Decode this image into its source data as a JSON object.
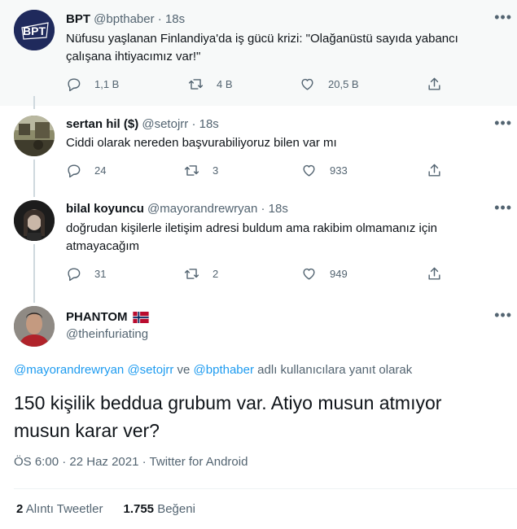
{
  "tweets": [
    {
      "name": "BPT",
      "handle": "@bpthaber",
      "time": "18s",
      "text_line1": "Nüfusu yaşlanan Finlandiya'da iş gücü krizi: \"Olağanüstü sayıda yabancı",
      "text_line2": "çalışana ihtiyacımız var!\"",
      "replies": "1,1 B",
      "retweets": "4 B",
      "likes": "20,5 B",
      "avatar_logo_text": "BPT"
    },
    {
      "name": "sertan hil ($)",
      "handle": "@setojrr",
      "time": "18s",
      "text_line1": "Ciddi olarak nereden başvurabiliyoruz bilen var mı",
      "replies": "24",
      "retweets": "3",
      "likes": "933"
    },
    {
      "name": "bilal koyuncu",
      "handle": "@mayorandrewryan",
      "time": "18s",
      "text_line1": "doğrudan kişilerle iletişim adresi buldum ama rakibim olmamanız için",
      "text_line2": "atmayacağım",
      "replies": "31",
      "retweets": "2",
      "likes": "949"
    }
  ],
  "separator_dot": "·",
  "main": {
    "name": "PHANTOM",
    "handle": "@theinfuriating",
    "reply_mentions": [
      "@mayorandrewryan",
      "@setojrr",
      "@bpthaber"
    ],
    "reply_ve": "ve",
    "reply_suffix": "adlı kullanıcılara yanıt olarak",
    "text_line1": "150 kişilik beddua grubum var. Atiyo musun atmıyor",
    "text_line2": "musun karar ver?",
    "time": "ÖS 6:00",
    "date": "22 Haz 2021",
    "source": "Twitter for Android",
    "quote_count": "2",
    "quote_label": "Alıntı Tweetler",
    "like_count": "1.755",
    "like_label": "Beğeni"
  },
  "colors": {
    "accent": "#1d9bf0",
    "text": "#0f1419",
    "secondary": "#536471",
    "highlight_bg": "#f7f9f9",
    "bpt_logo_bg": "#1f2a5c"
  },
  "icons": [
    "reply-icon",
    "retweet-icon",
    "like-icon",
    "share-icon",
    "more-icon",
    "norway-flag-icon"
  ]
}
